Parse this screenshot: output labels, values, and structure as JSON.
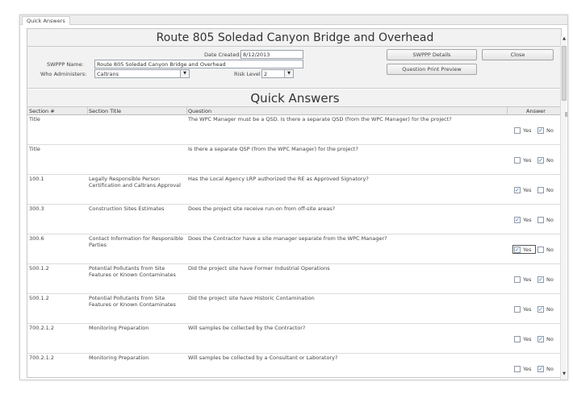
{
  "window": {
    "tab_label": "Quick Answers"
  },
  "header": {
    "title": "Route 805 Soledad Canyon Bridge and Overhead"
  },
  "form": {
    "date_created_label": "Date Created:",
    "date_created_value": "8/12/2013",
    "swppp_name_label": "SWPPP Name:",
    "swppp_name_value": "Route 805 Soledad Canyon Bridge and Overhead",
    "who_administers_label": "Who Administers:",
    "who_administers_value": "Caltrans",
    "risk_level_label": "Risk Level",
    "risk_level_value": "2"
  },
  "buttons": {
    "swppp_details": "SWPPP Details",
    "close": "Close",
    "question_print_preview": "Question Print Preview"
  },
  "section_title": "Quick Answers",
  "columns": {
    "section": "Section #",
    "section_title": "Section Title",
    "question": "Question",
    "answer": "Answer"
  },
  "yes_label": "Yes",
  "no_label": "No",
  "rows": [
    {
      "section": "Title",
      "section_title": "",
      "question": "The WPC Manager must be a QSD. Is there a separate QSD (from the WPC Manager) for the project?",
      "yes": false,
      "no": true
    },
    {
      "section": "Title",
      "section_title": "",
      "question": "Is there a separate QSP (from the WPC Manager) for the project?",
      "yes": false,
      "no": true
    },
    {
      "section": "100.1",
      "section_title": "Legally Responsible Person Certification and Caltrans Approval",
      "question": "Has the Local Agency LRP authorized the RE as Approved Signatory?",
      "yes": true,
      "no": false
    },
    {
      "section": "300.3",
      "section_title": "Construction Sites Estimates",
      "question": "Does the project site receive run-on from off-site areas?",
      "yes": true,
      "no": false
    },
    {
      "section": "300.6",
      "section_title": "Contact Information for Responsible Parties",
      "question": "Does the Contractor have a site manager separate from the WPC Manager?",
      "yes": true,
      "no": false
    },
    {
      "section": "500.1.2",
      "section_title": "Potential Pollutants from Site Features or Known Contaminates",
      "question": "Did the project site have Former Industrial Operations",
      "yes": false,
      "no": true
    },
    {
      "section": "500.1.2",
      "section_title": "Potential Pollutants from Site Features or Known Contaminates",
      "question": "Did the project site have Historic Contamination",
      "yes": false,
      "no": true
    },
    {
      "section": "700.2.1.2",
      "section_title": "Monitoring Preparation",
      "question": "Will samples be collected by the Contractor?",
      "yes": false,
      "no": true
    },
    {
      "section": "700.2.1.2",
      "section_title": "Monitoring Preparation",
      "question": "Will samples be collected by a Consultant or Laboratory?",
      "yes": false,
      "no": true
    }
  ]
}
